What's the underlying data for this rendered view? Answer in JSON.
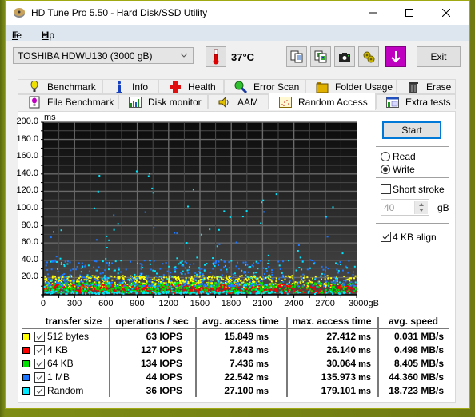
{
  "window": {
    "title": "HD Tune Pro 5.50 - Hard Disk/SSD Utility",
    "controls": {
      "minimize": "minimize-icon",
      "maximize": "maximize-icon",
      "close": "close-icon"
    }
  },
  "menu": {
    "items": [
      {
        "label": "File",
        "accel": "F"
      },
      {
        "label": "Help",
        "accel": "H"
      }
    ]
  },
  "toolbar": {
    "drive": "TOSHIBA HDWU130 (3000 gB)",
    "temperature": "37°C",
    "icons": [
      "copy-text-icon",
      "copy-screenshot-icon",
      "camera-icon",
      "options-icon",
      "save-download-icon"
    ],
    "exit_label": "Exit",
    "accent_download": "#c000c0"
  },
  "tabs": {
    "row1": [
      {
        "label": "Benchmark",
        "icon": "benchmark-icon"
      },
      {
        "label": "Info",
        "icon": "info-icon"
      },
      {
        "label": "Health",
        "icon": "health-icon"
      },
      {
        "label": "Error Scan",
        "icon": "error-scan-icon"
      },
      {
        "label": "Folder Usage",
        "icon": "folder-icon"
      },
      {
        "label": "Erase",
        "icon": "trash-icon"
      }
    ],
    "row2": [
      {
        "label": "File Benchmark",
        "icon": "file-benchmark-icon"
      },
      {
        "label": "Disk monitor",
        "icon": "disk-monitor-icon"
      },
      {
        "label": "AAM",
        "icon": "speaker-icon"
      },
      {
        "label": "Random Access",
        "icon": "random-access-icon",
        "active": true
      },
      {
        "label": "Extra tests",
        "icon": "extra-tests-icon"
      }
    ]
  },
  "controls": {
    "start_label": "Start",
    "mode_options": [
      {
        "label": "Read",
        "selected": false
      },
      {
        "label": "Write",
        "selected": true
      }
    ],
    "short_stroke": {
      "label": "Short stroke",
      "checked": false,
      "value": "40",
      "unit": "gB"
    },
    "align_4kb": {
      "label": "4 KB align",
      "checked": true
    }
  },
  "chart_data": {
    "type": "scatter",
    "title": "",
    "ylabel": "ms",
    "xlabel": "gB",
    "ylim": [
      0,
      200
    ],
    "xlim": [
      0,
      3000
    ],
    "yticks": [
      "200.0",
      "180.0",
      "160.0",
      "140.0",
      "120.0",
      "100.0",
      "80.0",
      "60.0",
      "40.0",
      "20.0"
    ],
    "xticks": [
      "0",
      "300",
      "600",
      "900",
      "1200",
      "1500",
      "1800",
      "2100",
      "2400",
      "2700",
      "3000gB"
    ],
    "grid": true,
    "series": [
      {
        "name": "512 bytes",
        "color": "#ffff00",
        "typical_range_ms": [
          8,
          22
        ]
      },
      {
        "name": "4 KB",
        "color": "#ff0000",
        "typical_range_ms": [
          2,
          12
        ]
      },
      {
        "name": "64 KB",
        "color": "#00e000",
        "typical_range_ms": [
          2,
          14
        ]
      },
      {
        "name": "1 MB",
        "color": "#1e78ff",
        "typical_range_ms": [
          10,
          40
        ]
      },
      {
        "name": "Random",
        "color": "#00e8ff",
        "typical_range_ms": [
          0,
          180
        ]
      }
    ]
  },
  "results": {
    "headers": [
      "transfer size",
      "operations / sec",
      "avg. access time",
      "max. access time",
      "avg. speed"
    ],
    "rows": [
      {
        "size": "512 bytes",
        "color": "#ffff00",
        "checked": true,
        "ops": "63 IOPS",
        "avg": "15.849 ms",
        "max": "27.412 ms",
        "speed": "0.031 MB/s"
      },
      {
        "size": "4 KB",
        "color": "#ff0000",
        "checked": true,
        "ops": "127 IOPS",
        "avg": "7.843 ms",
        "max": "26.140 ms",
        "speed": "0.498 MB/s"
      },
      {
        "size": "64 KB",
        "color": "#00e000",
        "checked": true,
        "ops": "134 IOPS",
        "avg": "7.436 ms",
        "max": "30.064 ms",
        "speed": "8.405 MB/s"
      },
      {
        "size": "1 MB",
        "color": "#1e78ff",
        "checked": true,
        "ops": "44 IOPS",
        "avg": "22.542 ms",
        "max": "135.973 ms",
        "speed": "44.360 MB/s"
      },
      {
        "size": "Random",
        "color": "#00e8ff",
        "checked": true,
        "ops": "36 IOPS",
        "avg": "27.100 ms",
        "max": "179.101 ms",
        "speed": "18.723 MB/s"
      }
    ]
  }
}
